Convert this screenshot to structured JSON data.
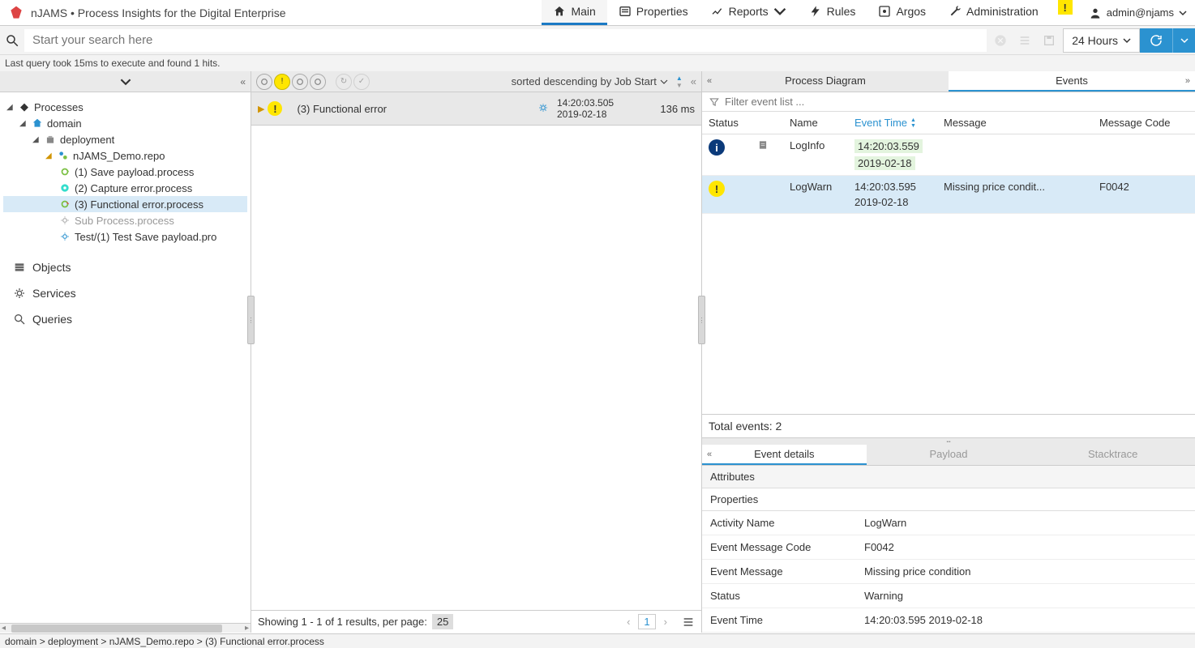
{
  "brand": {
    "title": "nJAMS • Process Insights for the Digital Enterprise"
  },
  "nav": {
    "main": "Main",
    "properties": "Properties",
    "reports": "Reports",
    "rules": "Rules",
    "argos": "Argos",
    "administration": "Administration"
  },
  "user": "admin@njams",
  "search": {
    "placeholder": "Start your search here",
    "time_range": "24 Hours"
  },
  "query_info": "Last query took 15ms to execute and found 1 hits.",
  "tree": {
    "root": "Processes",
    "domain": "domain",
    "deployment": "deployment",
    "repo": "nJAMS_Demo.repo",
    "p1": "(1) Save payload.process",
    "p2": "(2) Capture error.process",
    "p3": "(3) Functional error.process",
    "p4": "Sub Process.process",
    "p5": "Test/(1) Test Save payload.pro",
    "objects": "Objects",
    "services": "Services",
    "queries": "Queries"
  },
  "jobs": {
    "sort_label": "sorted descending by Job Start",
    "row": {
      "name": "(3) Functional error",
      "time": "14:20:03.505",
      "date": "2019-02-18",
      "duration": "136 ms"
    },
    "footer": "Showing 1 - 1 of 1 results, per page:",
    "page_size": "25",
    "current_page": "1"
  },
  "right_tabs": {
    "diagram": "Process Diagram",
    "events": "Events"
  },
  "events": {
    "filter_placeholder": "Filter event list ...",
    "headers": {
      "status": "Status",
      "name": "Name",
      "time": "Event Time",
      "message": "Message",
      "code": "Message Code"
    },
    "rows": [
      {
        "name": "LogInfo",
        "time": "14:20:03.559",
        "date": "2019-02-18",
        "message": "",
        "code": "",
        "status": "info"
      },
      {
        "name": "LogWarn",
        "time": "14:20:03.595",
        "date": "2019-02-18",
        "message": "Missing price condit...",
        "code": "F0042",
        "status": "warn"
      }
    ],
    "total": "Total events: 2"
  },
  "detail_tabs": {
    "details": "Event details",
    "payload": "Payload",
    "stacktrace": "Stacktrace"
  },
  "details": {
    "attributes": "Attributes",
    "properties": "Properties",
    "rows": [
      {
        "key": "Activity Name",
        "val": "LogWarn"
      },
      {
        "key": "Event Message Code",
        "val": "F0042"
      },
      {
        "key": "Event Message",
        "val": "Missing price condition"
      },
      {
        "key": "Status",
        "val": "Warning"
      },
      {
        "key": "Event Time",
        "val": "14:20:03.595   2019-02-18"
      }
    ]
  },
  "breadcrumb": "domain > deployment > nJAMS_Demo.repo > (3) Functional error.process"
}
